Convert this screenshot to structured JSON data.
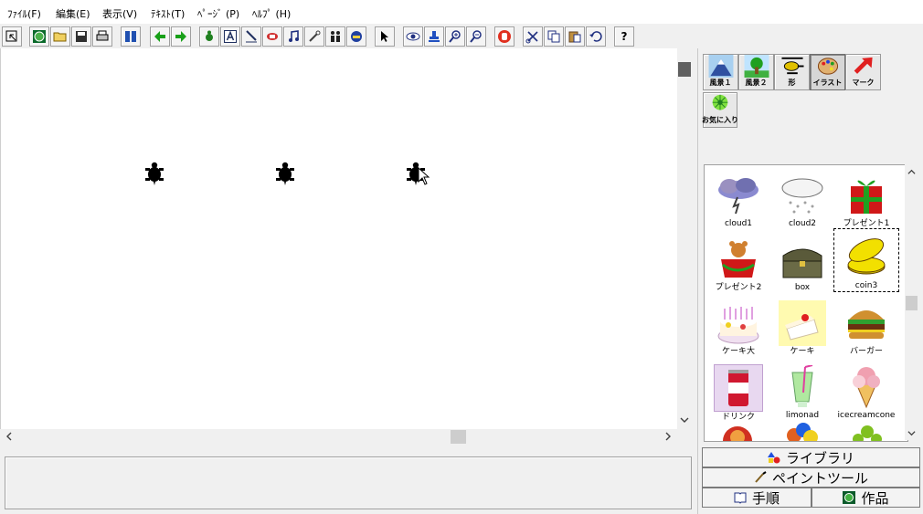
{
  "menu": {
    "file": "ﾌｧｲﾙ(F)",
    "edit": "編集(E)",
    "view": "表示(V)",
    "text": "ﾃｷｽﾄ(T)",
    "page": "ﾍﾟｰｼﾞ (P)",
    "help": "ﾍﾙﾌﾟ (H)"
  },
  "toolbar": {
    "help_glyph": "?"
  },
  "categories": [
    {
      "label": "風景１",
      "icon": "mountain-icon"
    },
    {
      "label": "風景２",
      "icon": "tree-icon"
    },
    {
      "label": "形",
      "icon": "helicopter-icon"
    },
    {
      "label": "イラスト",
      "icon": "palette-icon",
      "active": true
    },
    {
      "label": "マーク",
      "icon": "arrow-mark-icon"
    }
  ],
  "favorites": {
    "label": "お気に入り"
  },
  "library_items": [
    {
      "name": "cloud1",
      "icon": "storm-cloud-icon"
    },
    {
      "name": "cloud2",
      "icon": "snow-cloud-icon"
    },
    {
      "name": "プレゼント1",
      "icon": "gift-icon"
    },
    {
      "name": "プレゼント2",
      "icon": "gift-bear-icon"
    },
    {
      "name": "box",
      "icon": "treasure-box-icon"
    },
    {
      "name": "coin3",
      "icon": "coin-icon",
      "selected": true
    },
    {
      "name": "ケーキ大",
      "icon": "big-cake-icon"
    },
    {
      "name": "ケーキ",
      "icon": "cake-slice-icon"
    },
    {
      "name": "バーガー",
      "icon": "burger-icon"
    },
    {
      "name": "ドリンク",
      "icon": "can-drink-icon"
    },
    {
      "name": "limonad",
      "icon": "lemonade-icon"
    },
    {
      "name": "icecreamcone",
      "icon": "ice-cream-icon"
    }
  ],
  "bottom_tabs": {
    "library": "ライブラリ",
    "paint": "ペイントツール",
    "steps": "手順",
    "works": "作品"
  },
  "colors": {
    "accent_red": "#e02020",
    "turtle": "#000000",
    "coin": "#f2e000"
  }
}
